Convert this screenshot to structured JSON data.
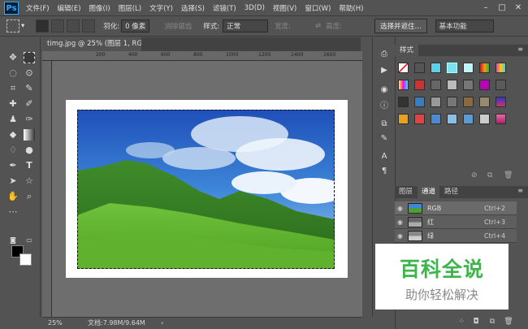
{
  "app": {
    "logo": "Ps"
  },
  "menu": [
    "文件(F)",
    "编辑(E)",
    "图像(I)",
    "图层(L)",
    "文字(Y)",
    "选择(S)",
    "滤镜(T)",
    "3D(D)",
    "视图(V)",
    "窗口(W)",
    "帮助(H)"
  ],
  "options": {
    "feather_label": "羽化:",
    "feather_value": "0 像素",
    "antialias_label": "消除锯齿",
    "style_label": "样式:",
    "style_value": "正常",
    "width_label": "宽度:",
    "height_label": "高度:",
    "select_mask_button": "选择并遮住...",
    "workspace_value": "基本功能"
  },
  "document": {
    "tab_title": "timg.jpg @ 25% (图层 1, RGB/8#) *",
    "ruler_ticks": [
      "0",
      "200",
      "400",
      "600",
      "800",
      "1000",
      "1200",
      "1400",
      "1600",
      "1800"
    ]
  },
  "status": {
    "zoom": "25%",
    "doc_info": "文档:7.98M/9.64M"
  },
  "styles_panel": {
    "tab_label": "样式"
  },
  "channels_panel": {
    "tabs": [
      "图层",
      "通道",
      "路径"
    ],
    "rows": [
      {
        "name": "RGB",
        "shortcut": "Ctrl+2"
      },
      {
        "name": "红",
        "shortcut": "Ctrl+3"
      },
      {
        "name": "绿",
        "shortcut": "Ctrl+4"
      }
    ]
  },
  "watermark": {
    "title": "百科全说",
    "subtitle": "助你轻松解决"
  },
  "colors": {
    "ui_bg": "#535353",
    "accent": "#31a8ff",
    "watermark_green": "#3cb54a"
  }
}
